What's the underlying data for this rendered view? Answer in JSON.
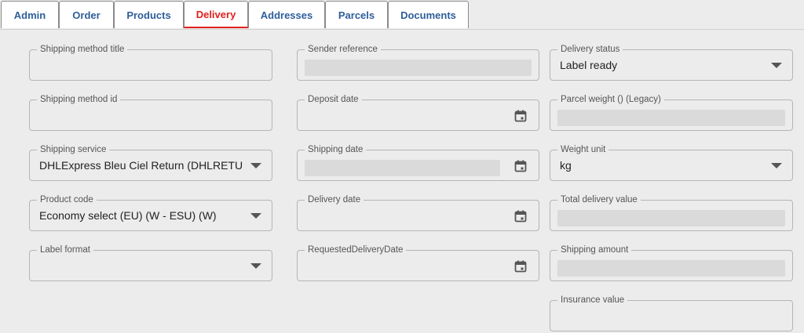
{
  "tabs": [
    {
      "label": "Admin"
    },
    {
      "label": "Order"
    },
    {
      "label": "Products"
    },
    {
      "label": "Delivery"
    },
    {
      "label": "Addresses"
    },
    {
      "label": "Parcels"
    },
    {
      "label": "Documents"
    }
  ],
  "active_tab": "Delivery",
  "colors": {
    "active_tab": "#e0201c",
    "tab_text": "#2e5e9a",
    "background": "#ececec"
  },
  "fields": {
    "shipping_method_title": {
      "label": "Shipping method title",
      "value": ""
    },
    "shipping_method_id": {
      "label": "Shipping method id",
      "value": ""
    },
    "shipping_service": {
      "label": "Shipping service",
      "value": "DHLExpress Bleu Ciel Return (DHLRETURN"
    },
    "product_code": {
      "label": "Product code",
      "value": "Economy select (EU) (W - ESU) (W)"
    },
    "label_format": {
      "label": "Label format",
      "value": ""
    },
    "sender_reference": {
      "label": "Sender reference",
      "value": ""
    },
    "deposit_date": {
      "label": "Deposit date",
      "value": ""
    },
    "shipping_date": {
      "label": "Shipping date",
      "value": ""
    },
    "delivery_date": {
      "label": "Delivery date",
      "value": ""
    },
    "requested_delivery_date": {
      "label": "RequestedDeliveryDate",
      "value": ""
    },
    "delivery_status": {
      "label": "Delivery status",
      "value": "Label ready"
    },
    "parcel_weight": {
      "label": "Parcel weight () (Legacy)",
      "value": ""
    },
    "weight_unit": {
      "label": "Weight unit",
      "value": "kg"
    },
    "total_delivery_value": {
      "label": "Total delivery value",
      "value": ""
    },
    "shipping_amount": {
      "label": "Shipping amount",
      "value": ""
    },
    "insurance_value": {
      "label": "Insurance value",
      "value": ""
    }
  },
  "icons": {
    "select": "chevron-down-icon",
    "date": "calendar-icon"
  }
}
